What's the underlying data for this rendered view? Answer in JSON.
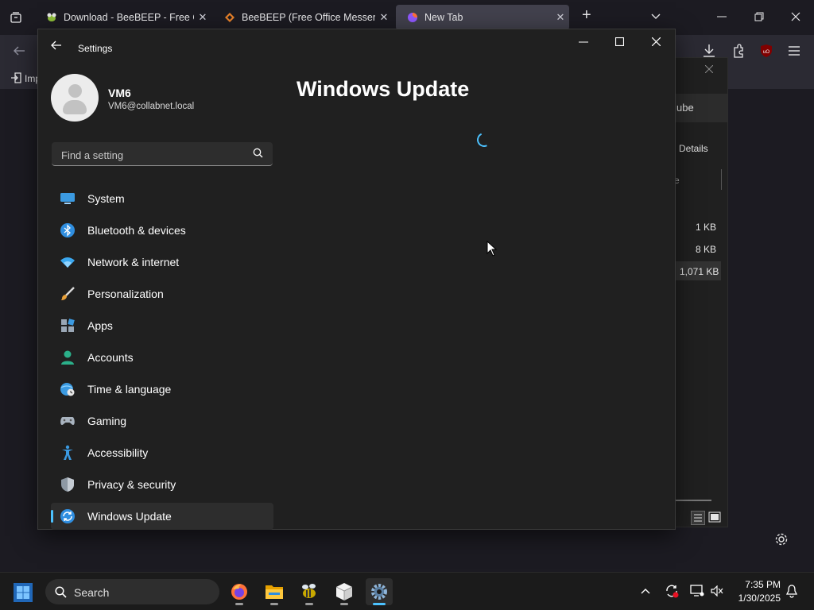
{
  "browser": {
    "tabs": [
      {
        "title": "Download - BeeBEEP - Free Offi",
        "close": "✕"
      },
      {
        "title": "BeeBEEP (Free Office Messenge",
        "close": "✕"
      },
      {
        "title": "New Tab",
        "close": "✕"
      }
    ],
    "new_tab": "+",
    "bookmark_label": "Imp"
  },
  "background_window": {
    "search_fragment": "ube",
    "details_label": "Details",
    "column_fragment": "e",
    "file_sizes": [
      "1 KB",
      "8 KB",
      "1,071 KB"
    ]
  },
  "settings": {
    "app_title": "Settings",
    "user": {
      "name": "VM6",
      "email": "VM6@collabnet.local"
    },
    "search": {
      "placeholder": "Find a setting"
    },
    "nav": [
      {
        "label": "System",
        "icon": "system-icon"
      },
      {
        "label": "Bluetooth & devices",
        "icon": "bluetooth-icon"
      },
      {
        "label": "Network & internet",
        "icon": "network-icon"
      },
      {
        "label": "Personalization",
        "icon": "brush-icon"
      },
      {
        "label": "Apps",
        "icon": "apps-icon"
      },
      {
        "label": "Accounts",
        "icon": "accounts-icon"
      },
      {
        "label": "Time & language",
        "icon": "globe-clock-icon"
      },
      {
        "label": "Gaming",
        "icon": "gamepad-icon"
      },
      {
        "label": "Accessibility",
        "icon": "accessibility-icon"
      },
      {
        "label": "Privacy & security",
        "icon": "shield-icon"
      },
      {
        "label": "Windows Update",
        "icon": "update-icon",
        "selected": true
      }
    ],
    "page_title": "Windows Update",
    "accent_color": "#4cc2ff"
  },
  "taskbar": {
    "search_label": "Search",
    "time": "7:35 PM",
    "date": "1/30/2025",
    "apps": [
      "firefox-icon",
      "file-explorer-icon",
      "beebeep-icon",
      "package-icon",
      "settings-icon"
    ]
  }
}
